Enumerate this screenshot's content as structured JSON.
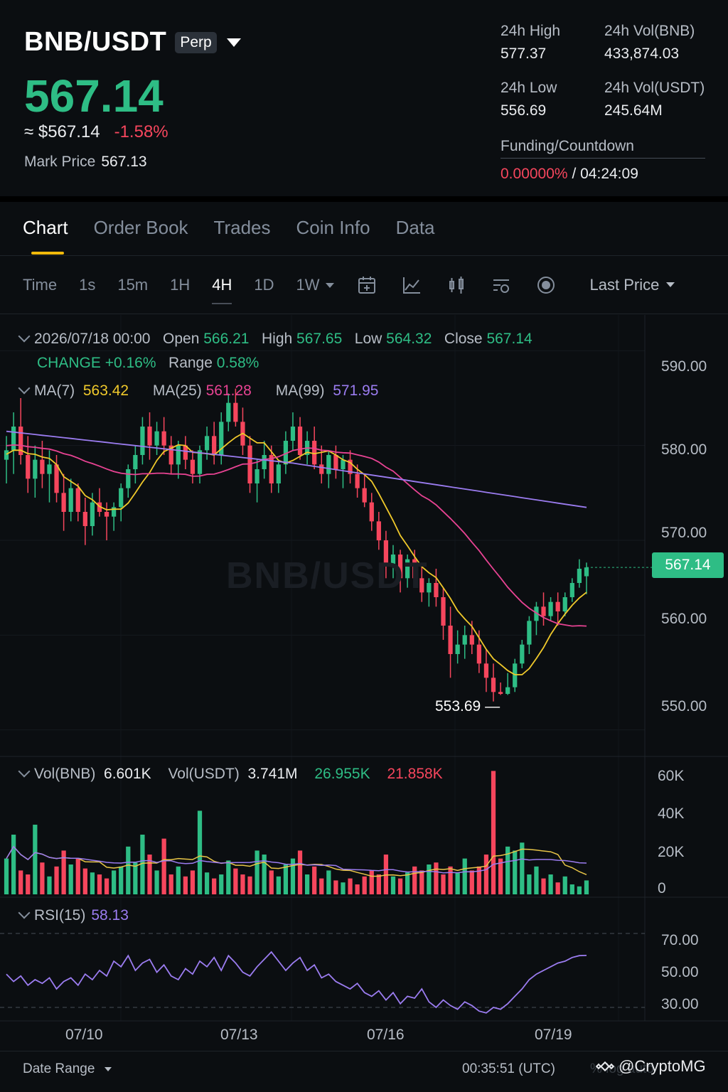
{
  "header": {
    "pair": "BNB/USDT",
    "badge": "Perp",
    "last_price": "567.14",
    "approx_usd": "≈ $567.14",
    "change_pct": "-1.58%",
    "mark_label": "Mark Price",
    "mark_value": "567.13",
    "stats": {
      "high_label": "24h High",
      "high_value": "577.37",
      "vol_bnb_label": "24h Vol(BNB)",
      "vol_bnb_value": "433,874.03",
      "low_label": "24h Low",
      "low_value": "556.69",
      "vol_usdt_label": "24h Vol(USDT)",
      "vol_usdt_value": "245.64M"
    },
    "funding_label": "Funding/Countdown",
    "funding_rate": "0.00000%",
    "funding_sep": "/",
    "countdown": "04:24:09"
  },
  "tabs": [
    "Chart",
    "Order Book",
    "Trades",
    "Coin Info",
    "Data"
  ],
  "toolbar": {
    "timeframes": [
      "Time",
      "1s",
      "15m",
      "1H",
      "4H",
      "1D",
      "1W"
    ],
    "active_timeframe": "4H",
    "price_type": "Last Price",
    "icons": [
      "calendar-icon",
      "indicator-icon",
      "chart-type-icon",
      "settings-icon",
      "target-icon"
    ]
  },
  "ohlc": {
    "date": "2026/07/18 00:00",
    "open_label": "Open",
    "open": "566.21",
    "high_label": "High",
    "high": "567.65",
    "low_label": "Low",
    "low": "564.32",
    "close_label": "Close",
    "close": "567.14",
    "change_label": "CHANGE",
    "change": "+0.16%",
    "range_label": "Range",
    "range": "0.58%"
  },
  "ma": {
    "ma7_label": "MA(7)",
    "ma7": "563.42",
    "ma25_label": "MA(25)",
    "ma25": "561.28",
    "ma99_label": "MA(99)",
    "ma99": "571.95"
  },
  "volume": {
    "bnb_label": "Vol(BNB)",
    "bnb": "6.601K",
    "usdt_label": "Vol(USDT)",
    "usdt": "3.741M",
    "ma_a": "26.955K",
    "ma_b": "21.858K"
  },
  "rsi": {
    "label": "RSI(15)",
    "value": "58.13"
  },
  "current_price_tag": "567.14",
  "low_marker": "553.69",
  "watermark": "BNB/USDT",
  "footer": {
    "date_range": "Date Range",
    "utc_time": "00:35:51 (UTC)",
    "options": "% log auto",
    "credit": "@CryptoMG"
  },
  "colors": {
    "up": "#2ebd85",
    "down": "#f6465d",
    "ma7": "#f0c92b",
    "ma25": "#e84393",
    "ma99": "#9b7cf0",
    "accent": "#f0b90b"
  },
  "chart_data": {
    "type": "candlestick",
    "price_axis": {
      "ticks": [
        "590.00",
        "580.00",
        "570.00",
        "560.00",
        "550.00"
      ],
      "range": [
        547.5,
        592.5
      ]
    },
    "volume_axis": {
      "ticks": [
        "60K",
        "40K",
        "20K",
        "0"
      ],
      "range": [
        0,
        60000
      ]
    },
    "rsi_axis": {
      "ticks": [
        "70.00",
        "50.00",
        "30.00"
      ],
      "range": [
        25,
        75
      ]
    },
    "x_labels": [
      "07/10",
      "07/13",
      "07/16",
      "07/19"
    ],
    "candles": [
      [
        578.5,
        581.0,
        576.0,
        579.5
      ],
      [
        579.5,
        583.5,
        577.0,
        582.0
      ],
      [
        582.0,
        585.0,
        578.0,
        579.0
      ],
      [
        579.0,
        581.0,
        575.0,
        576.5
      ],
      [
        576.5,
        580.0,
        574.5,
        578.5
      ],
      [
        578.5,
        580.5,
        575.5,
        577.0
      ],
      [
        577.0,
        579.5,
        574.0,
        578.0
      ],
      [
        578.0,
        579.0,
        574.0,
        575.0
      ],
      [
        575.0,
        577.0,
        571.0,
        573.0
      ],
      [
        573.0,
        576.5,
        572.0,
        575.5
      ],
      [
        575.5,
        576.0,
        572.0,
        573.0
      ],
      [
        573.0,
        574.5,
        569.5,
        571.5
      ],
      [
        571.5,
        575.0,
        570.5,
        574.0
      ],
      [
        574.0,
        575.5,
        572.5,
        573.0
      ],
      [
        573.0,
        574.0,
        570.0,
        572.5
      ],
      [
        572.5,
        574.0,
        571.0,
        573.5
      ],
      [
        573.5,
        576.0,
        572.0,
        575.5
      ],
      [
        575.5,
        578.0,
        574.5,
        577.5
      ],
      [
        577.5,
        580.0,
        576.0,
        579.0
      ],
      [
        579.0,
        583.0,
        578.0,
        582.0
      ],
      [
        582.0,
        583.5,
        578.5,
        580.0
      ],
      [
        580.0,
        582.5,
        579.0,
        581.5
      ],
      [
        581.5,
        583.0,
        579.0,
        580.0
      ],
      [
        580.0,
        581.0,
        577.0,
        578.0
      ],
      [
        578.0,
        580.5,
        576.5,
        580.0
      ],
      [
        580.0,
        581.0,
        577.5,
        578.5
      ],
      [
        578.5,
        579.5,
        576.0,
        577.0
      ],
      [
        577.0,
        580.0,
        576.0,
        579.5
      ],
      [
        579.5,
        582.0,
        578.5,
        581.0
      ],
      [
        581.0,
        582.5,
        578.0,
        579.0
      ],
      [
        579.0,
        583.5,
        578.0,
        582.5
      ],
      [
        582.5,
        585.5,
        581.5,
        584.5
      ],
      [
        584.5,
        586.0,
        582.0,
        582.5
      ],
      [
        582.5,
        584.0,
        579.0,
        580.0
      ],
      [
        580.0,
        581.0,
        575.0,
        576.0
      ],
      [
        576.0,
        578.5,
        574.0,
        577.5
      ],
      [
        577.5,
        580.5,
        576.5,
        579.0
      ],
      [
        579.0,
        580.0,
        575.0,
        576.0
      ],
      [
        576.0,
        578.5,
        575.0,
        578.0
      ],
      [
        578.0,
        581.5,
        577.0,
        580.5
      ],
      [
        580.5,
        583.5,
        579.5,
        582.0
      ],
      [
        582.0,
        583.0,
        578.5,
        579.0
      ],
      [
        579.0,
        581.5,
        578.0,
        580.5
      ],
      [
        580.5,
        582.0,
        577.5,
        578.0
      ],
      [
        578.0,
        580.0,
        576.0,
        577.0
      ],
      [
        577.0,
        579.5,
        575.5,
        579.0
      ],
      [
        579.0,
        580.0,
        576.5,
        577.5
      ],
      [
        577.5,
        579.0,
        575.5,
        578.5
      ],
      [
        578.5,
        579.5,
        576.0,
        577.0
      ],
      [
        577.0,
        578.0,
        574.5,
        575.5
      ],
      [
        575.5,
        577.0,
        573.5,
        574.0
      ],
      [
        574.0,
        575.0,
        571.0,
        572.0
      ],
      [
        572.0,
        573.0,
        569.0,
        570.0
      ],
      [
        570.0,
        571.0,
        566.0,
        567.5
      ],
      [
        567.5,
        569.5,
        566.0,
        568.5
      ],
      [
        568.5,
        569.0,
        564.5,
        566.0
      ],
      [
        566.0,
        568.5,
        565.0,
        568.0
      ],
      [
        568.0,
        569.0,
        565.0,
        566.0
      ],
      [
        566.0,
        567.5,
        563.5,
        564.5
      ],
      [
        564.5,
        566.0,
        563.0,
        565.5
      ],
      [
        565.5,
        567.0,
        563.0,
        564.0
      ],
      [
        564.0,
        565.0,
        559.5,
        561.0
      ],
      [
        561.0,
        563.0,
        555.5,
        558.0
      ],
      [
        558.0,
        560.5,
        557.0,
        559.0
      ],
      [
        559.0,
        561.0,
        557.5,
        560.0
      ],
      [
        560.0,
        561.5,
        558.0,
        559.0
      ],
      [
        559.0,
        560.5,
        556.0,
        557.0
      ],
      [
        557.0,
        558.5,
        554.0,
        555.5
      ],
      [
        555.5,
        557.0,
        553.0,
        554.0
      ],
      [
        554.0,
        555.0,
        553.69,
        553.8
      ],
      [
        553.8,
        556.0,
        553.69,
        554.5
      ],
      [
        554.5,
        557.5,
        554.0,
        557.0
      ],
      [
        557.0,
        559.5,
        556.5,
        559.0
      ],
      [
        559.0,
        562.0,
        558.0,
        561.5
      ],
      [
        561.5,
        563.5,
        560.0,
        563.0
      ],
      [
        563.0,
        564.5,
        561.0,
        562.0
      ],
      [
        562.0,
        564.0,
        561.5,
        563.5
      ],
      [
        563.5,
        564.5,
        561.0,
        562.5
      ],
      [
        562.5,
        564.5,
        562.0,
        564.0
      ],
      [
        564.0,
        566.0,
        563.5,
        565.5
      ],
      [
        565.5,
        568.0,
        565.0,
        567.0
      ],
      [
        566.21,
        567.65,
        564.32,
        567.14
      ]
    ],
    "volumes": [
      18,
      30,
      12,
      10,
      35,
      16,
      9,
      14,
      22,
      15,
      18,
      13,
      11,
      10,
      8,
      12,
      14,
      24,
      16,
      30,
      20,
      12,
      28,
      10,
      14,
      9,
      12,
      42,
      11,
      8,
      10,
      17,
      13,
      10,
      9,
      22,
      20,
      12,
      9,
      15,
      18,
      22,
      10,
      14,
      8,
      12,
      7,
      6,
      8,
      5,
      9,
      12,
      10,
      20,
      9,
      8,
      11,
      14,
      12,
      15,
      16,
      10,
      14,
      11,
      18,
      12,
      14,
      20,
      62,
      18,
      24,
      22,
      26,
      10,
      14,
      8,
      10,
      6,
      9,
      5,
      4,
      7
    ],
    "rsi": [
      48,
      44,
      47,
      42,
      45,
      43,
      46,
      40,
      44,
      46,
      42,
      48,
      45,
      50,
      47,
      55,
      52,
      58,
      50,
      54,
      56,
      49,
      53,
      47,
      45,
      51,
      48,
      55,
      52,
      57,
      50,
      58,
      54,
      49,
      47,
      52,
      56,
      60,
      55,
      50,
      54,
      57,
      50,
      53,
      46,
      48,
      44,
      42,
      40,
      43,
      38,
      36,
      39,
      34,
      38,
      32,
      36,
      35,
      40,
      33,
      30,
      34,
      31,
      29,
      33,
      31,
      28,
      27,
      30,
      29,
      32,
      36,
      40,
      45,
      48,
      50,
      52,
      54,
      55,
      57,
      58,
      58.13
    ]
  }
}
